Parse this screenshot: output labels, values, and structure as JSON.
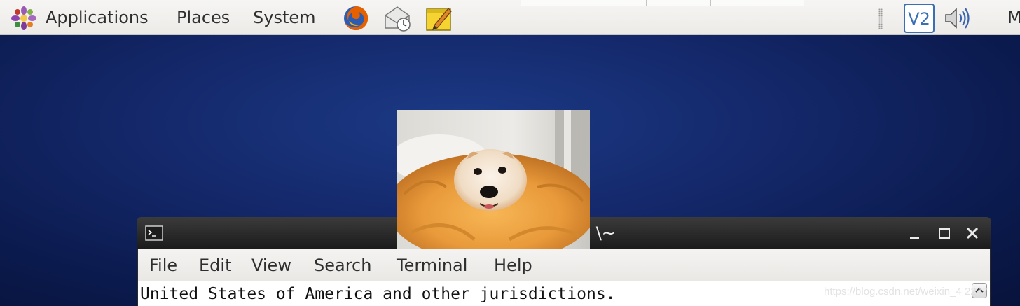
{
  "top_panel": {
    "menus": {
      "applications": "Applications",
      "places": "Places",
      "system": "System"
    },
    "launchers": [
      "firefox-icon",
      "mail-clock-icon",
      "notes-pencil-icon"
    ],
    "tray": {
      "vmware_label": "V2",
      "cutoff_text": "M"
    }
  },
  "terminal": {
    "title": ": \\~",
    "menus": {
      "file": "File",
      "edit": "Edit",
      "view": "View",
      "search": "Search",
      "terminal": "Terminal",
      "help": "Help"
    },
    "line": "United States of America and other jurisdictions."
  },
  "watermark": "https://blog.csdn.net/weixin_4  2247",
  "colors": {
    "desktop": "#14286a",
    "panel": "#efeeeb",
    "titlebar": "#2a2a2a"
  }
}
